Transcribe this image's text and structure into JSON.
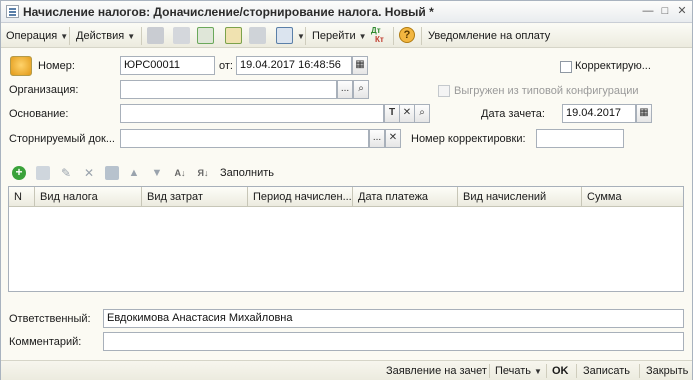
{
  "window": {
    "title": "Начисление налогов: Доначисление/сторнирование налога. Новый *",
    "minimize_glyph": "—",
    "maximize_glyph": "□",
    "close_glyph": "✕"
  },
  "toolbar": {
    "operation_label": "Операция",
    "actions_label": "Действия",
    "goto_label": "Перейти",
    "dt_kt_label_top": "Дт",
    "dt_kt_label_bottom": "Кт",
    "help_label": "?",
    "payment_notice_label": "Уведомление на оплату",
    "caret": "▼"
  },
  "form": {
    "number_label": "Номер:",
    "number_value": "ЮРС00011",
    "from_label": "от:",
    "date_value": "19.04.2017 16:48:56",
    "correction_label": "Корректирую...",
    "organization_label": "Организация:",
    "organization_value": "",
    "exported_label": "Выгружен из типовой конфигурации",
    "basis_label": "Основание:",
    "basis_value": "",
    "basis_type_btn": "T",
    "clear_btn": "✕",
    "offset_date_label": "Дата зачета:",
    "offset_date_value": "19.04.2017",
    "reversed_doc_label": "Сторнируемый док...",
    "reversed_doc_value": "",
    "correction_number_label": "Номер корректировки:",
    "correction_number_value": "",
    "ellipsis_btn": "...",
    "responsible_label": "Ответственный:",
    "responsible_value": "Евдокимова Анастасия Михайловна",
    "comment_label": "Комментарий:",
    "comment_value": ""
  },
  "grid_toolbar": {
    "fill_label": "Заполнить"
  },
  "table": {
    "columns": [
      "N",
      "Вид налога",
      "Вид затрат",
      "Период начислен...",
      "Дата платежа",
      "Вид начислений",
      "Сумма"
    ],
    "rows": []
  },
  "statusbar": {
    "offset_statement_label": "Заявление на зачет",
    "print_label": "Печать",
    "ok_label": "OK",
    "save_label": "Записать",
    "close_label": "Закрыть",
    "caret": "▼"
  },
  "colors": {
    "window_bg": "#fbfaf3",
    "accent_green": "#3aa23a",
    "accent_orange": "#e6a21a",
    "border": "#a8b0ba"
  }
}
